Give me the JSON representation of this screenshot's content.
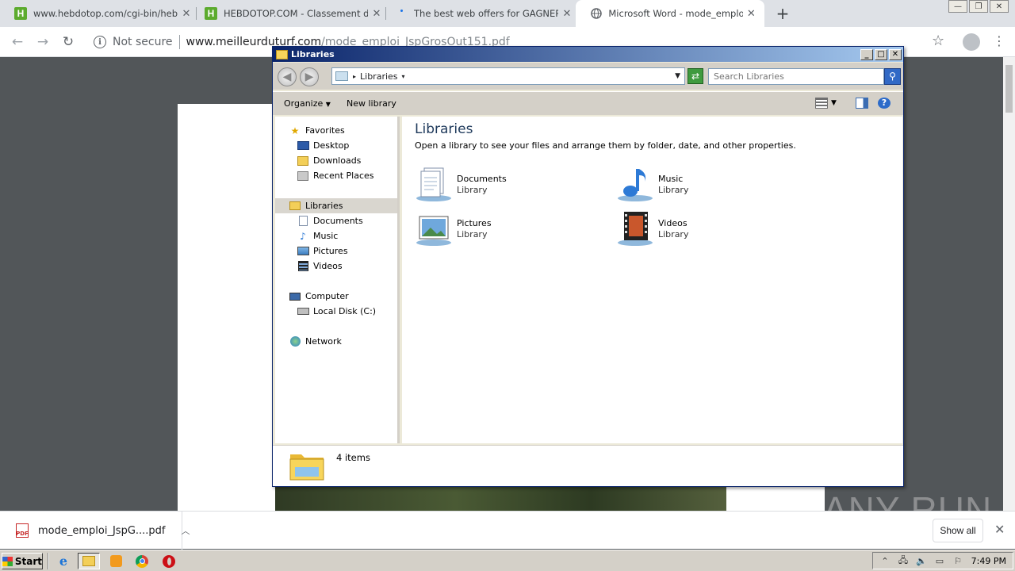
{
  "browser": {
    "tabs": [
      {
        "title": "www.hebdotop.com/cgi-bin/hebdoto",
        "icon": "hebdotop-favicon"
      },
      {
        "title": "HEBDOTOP.COM - Classement de sit",
        "icon": "hebdotop-favicon"
      },
      {
        "title": "The best web offers for GAGNER AU",
        "icon": "loading-dot"
      },
      {
        "title": "Microsoft Word - mode_emploi_JspG",
        "icon": "globe-icon"
      }
    ],
    "new_tab_label": "+",
    "address": {
      "security_label": "Not secure",
      "host": "www.meilleurduturf.com",
      "path": "/mode_emploi_JspGrosOut151.pdf"
    }
  },
  "explorer": {
    "title": "Libraries",
    "address_crumb": "Libraries",
    "search_placeholder": "Search Libraries",
    "commands": {
      "organize": "Organize",
      "new_library": "New library"
    },
    "nav": {
      "favorites": "Favorites",
      "desktop": "Desktop",
      "downloads": "Downloads",
      "recent_places": "Recent Places",
      "libraries": "Libraries",
      "documents": "Documents",
      "music": "Music",
      "pictures": "Pictures",
      "videos": "Videos",
      "computer": "Computer",
      "local_disk": "Local Disk (C:)",
      "network": "Network"
    },
    "content": {
      "heading": "Libraries",
      "description": "Open a library to see your files and arrange them by folder, date, and other properties.",
      "libraries": [
        {
          "name": "Documents",
          "type": "Library"
        },
        {
          "name": "Music",
          "type": "Library"
        },
        {
          "name": "Pictures",
          "type": "Library"
        },
        {
          "name": "Videos",
          "type": "Library"
        }
      ]
    },
    "details": {
      "count": "4 items"
    }
  },
  "downloads": {
    "file_name": "mode_emploi_JspG....pdf",
    "show_all": "Show all"
  },
  "watermark": "ANY RUN",
  "taskbar": {
    "start_label": "Start",
    "clock": "7:49 PM"
  }
}
